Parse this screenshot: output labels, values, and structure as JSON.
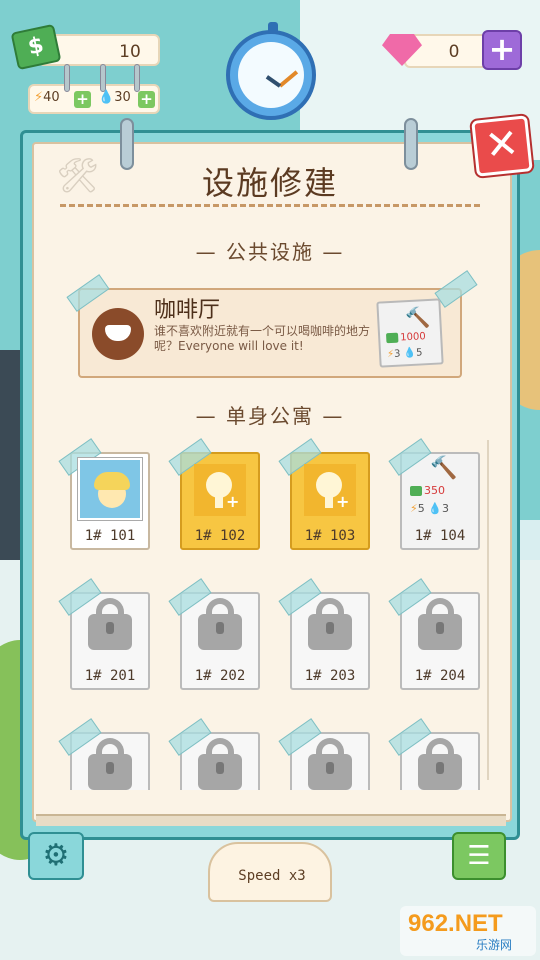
{
  "hud": {
    "money": "10",
    "energy": "40",
    "water": "30",
    "gems": "0"
  },
  "panel": {
    "title": "设施修建",
    "public_section": "— 公共设施 —",
    "apartment_section": "— 单身公寓 —"
  },
  "cafe": {
    "name": "咖啡厅",
    "description": "谁不喜欢附近就有一个可以喝咖啡的地方呢？Everyone will love it!",
    "cost": "1000",
    "energy": "3",
    "water": "5"
  },
  "rooms": [
    {
      "label": "1# 101",
      "state": "occupied"
    },
    {
      "label": "1# 102",
      "state": "unlockable"
    },
    {
      "label": "1# 103",
      "state": "unlockable"
    },
    {
      "label": "1# 104",
      "state": "buildable",
      "cost": "350",
      "energy": "5",
      "water": "3"
    },
    {
      "label": "1# 201",
      "state": "locked"
    },
    {
      "label": "1# 202",
      "state": "locked"
    },
    {
      "label": "1# 203",
      "state": "locked"
    },
    {
      "label": "1# 204",
      "state": "locked"
    },
    {
      "label": "",
      "state": "locked"
    },
    {
      "label": "",
      "state": "locked"
    },
    {
      "label": "",
      "state": "locked"
    },
    {
      "label": "",
      "state": "locked"
    }
  ],
  "bottom": {
    "speed": "Speed x3"
  },
  "watermark": {
    "main": "962.NET",
    "sub": "乐游网"
  },
  "colors": {
    "panel_border": "#2f8f93",
    "close_red": "#ea4b4b",
    "cost_red": "#d63a3a",
    "title_brown": "#5b3a21"
  }
}
